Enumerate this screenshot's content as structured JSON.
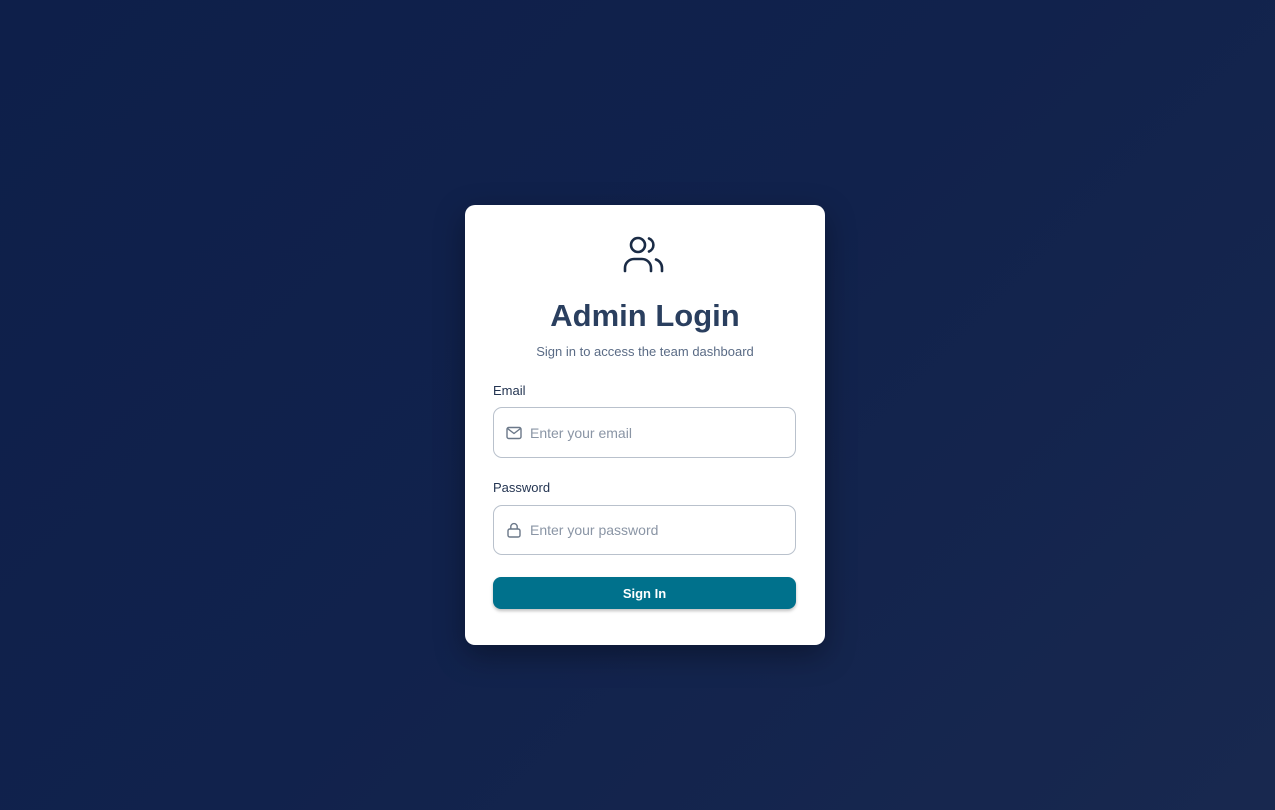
{
  "login": {
    "title": "Admin Login",
    "subtitle": "Sign in to access the team dashboard",
    "logo_icon": "users-icon",
    "email": {
      "label": "Email",
      "placeholder": "Enter your email",
      "value": "",
      "icon": "mail-icon"
    },
    "password": {
      "label": "Password",
      "placeholder": "Enter your password",
      "value": "",
      "icon": "lock-icon"
    },
    "submit_label": "Sign In"
  },
  "colors": {
    "background_start": "#0e1f4a",
    "background_end": "#18284f",
    "title": "#2a3f5f",
    "button": "#00718c",
    "card": "#ffffff"
  }
}
